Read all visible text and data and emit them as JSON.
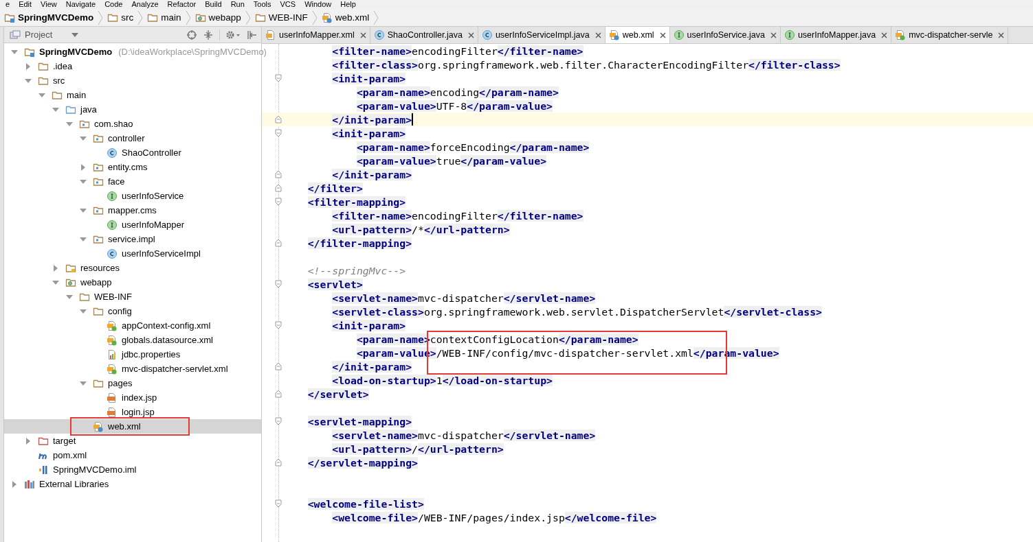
{
  "menu": [
    "e",
    "Edit",
    "View",
    "Navigate",
    "Code",
    "Analyze",
    "Refactor",
    "Build",
    "Run",
    "Tools",
    "VCS",
    "Window",
    "Help"
  ],
  "breadcrumbs": [
    {
      "label": "SpringMVCDemo",
      "kind": "project"
    },
    {
      "label": "src",
      "kind": "folder"
    },
    {
      "label": "main",
      "kind": "folder"
    },
    {
      "label": "webapp",
      "kind": "web"
    },
    {
      "label": "WEB-INF",
      "kind": "folder"
    },
    {
      "label": "web.xml",
      "kind": "webxml"
    }
  ],
  "project_panel": {
    "title": "Project",
    "items": [
      {
        "label": "SpringMVCDemo",
        "path": "(D:\\ideaWorkplace\\SpringMVCDemo)",
        "kind": "project",
        "expanded": true,
        "selected": false,
        "children": [
          {
            "label": ".idea",
            "kind": "folder",
            "expanded": false,
            "selected": false
          },
          {
            "label": "src",
            "kind": "folder",
            "expanded": true,
            "selected": false,
            "children": [
              {
                "label": "main",
                "kind": "folder",
                "expanded": true,
                "selected": false,
                "children": [
                  {
                    "label": "java",
                    "kind": "source",
                    "expanded": true,
                    "selected": false,
                    "children": [
                      {
                        "label": "com.shao",
                        "kind": "package",
                        "expanded": true,
                        "selected": false,
                        "children": [
                          {
                            "label": "controller",
                            "kind": "package",
                            "expanded": true,
                            "selected": false,
                            "children": [
                              {
                                "label": "ShaoController",
                                "kind": "class",
                                "selected": false
                              }
                            ]
                          },
                          {
                            "label": "entity.cms",
                            "kind": "package",
                            "expanded": false,
                            "selected": false
                          },
                          {
                            "label": "face",
                            "kind": "package",
                            "expanded": true,
                            "selected": false,
                            "children": [
                              {
                                "label": "userInfoService",
                                "kind": "interface",
                                "selected": false
                              }
                            ]
                          },
                          {
                            "label": "mapper.cms",
                            "kind": "package",
                            "expanded": true,
                            "selected": false,
                            "children": [
                              {
                                "label": "userInfoMapper",
                                "kind": "interface",
                                "selected": false
                              }
                            ]
                          },
                          {
                            "label": "service.impl",
                            "kind": "package",
                            "expanded": true,
                            "selected": false,
                            "children": [
                              {
                                "label": "userInfoServiceImpl",
                                "kind": "class",
                                "selected": false
                              }
                            ]
                          }
                        ]
                      }
                    ]
                  },
                  {
                    "label": "resources",
                    "kind": "resources",
                    "expanded": false,
                    "selected": false
                  },
                  {
                    "label": "webapp",
                    "kind": "web",
                    "expanded": true,
                    "selected": false,
                    "children": [
                      {
                        "label": "WEB-INF",
                        "kind": "folder",
                        "expanded": true,
                        "selected": false,
                        "children": [
                          {
                            "label": "config",
                            "kind": "folder",
                            "expanded": true,
                            "selected": false,
                            "children": [
                              {
                                "label": "appContext-config.xml",
                                "kind": "springxml",
                                "selected": false
                              },
                              {
                                "label": "globals.datasource.xml",
                                "kind": "springxml",
                                "selected": false
                              },
                              {
                                "label": "jdbc.properties",
                                "kind": "properties",
                                "selected": false
                              },
                              {
                                "label": "mvc-dispatcher-servlet.xml",
                                "kind": "springxml",
                                "selected": false
                              }
                            ]
                          },
                          {
                            "label": "pages",
                            "kind": "folder",
                            "expanded": true,
                            "selected": false,
                            "children": [
                              {
                                "label": "index.jsp",
                                "kind": "jsp",
                                "selected": false
                              },
                              {
                                "label": "login.jsp",
                                "kind": "jsp",
                                "selected": false
                              }
                            ]
                          },
                          {
                            "label": "web.xml",
                            "kind": "webxml",
                            "selected": true,
                            "annotated": true
                          }
                        ]
                      }
                    ]
                  }
                ]
              }
            ]
          },
          {
            "label": "target",
            "kind": "excluded",
            "expanded": false,
            "selected": false
          },
          {
            "label": "pom.xml",
            "kind": "maven",
            "selected": false
          },
          {
            "label": "SpringMVCDemo.iml",
            "kind": "iml",
            "selected": false
          }
        ]
      },
      {
        "label": "External Libraries",
        "kind": "library",
        "expanded": false,
        "selected": false
      }
    ]
  },
  "tabs": [
    {
      "label": "userInfoMapper.xml",
      "kind": "xml",
      "selected": false
    },
    {
      "label": "ShaoController.java",
      "kind": "class",
      "selected": false
    },
    {
      "label": "userInfoServiceImpl.java",
      "kind": "class",
      "selected": false
    },
    {
      "label": "web.xml",
      "kind": "webxml",
      "selected": true
    },
    {
      "label": "userInfoService.java",
      "kind": "interface",
      "selected": false
    },
    {
      "label": "userInfoMapper.java",
      "kind": "interface",
      "selected": false
    },
    {
      "label": "mvc-dispatcher-servle",
      "kind": "springxml",
      "selected": false
    }
  ],
  "editor": {
    "lines": [
      {
        "kind": "continued",
        "children": [
          {
            "kind": "code",
            "segments": [
              {
                "kind": "tag",
                "text": "<filter-name>"
              },
              {
                "kind": "text",
                "text": "encodingFilter"
              },
              {
                "kind": "tag",
                "text": "</filter-name>"
              }
            ]
          },
          {
            "kind": "code",
            "segments": [
              {
                "kind": "tag",
                "text": "<filter-class>"
              },
              {
                "kind": "text",
                "text": "org.springframework.web.filter.CharacterEncodingFilter"
              },
              {
                "kind": "tag",
                "text": "</filter-class>"
              }
            ]
          },
          {
            "kind": "code",
            "fold_start": true,
            "segments": [
              {
                "kind": "tag",
                "text": "<init-param>"
              }
            ],
            "children": [
              {
                "kind": "code",
                "segments": [
                  {
                    "kind": "tag",
                    "text": "<param-name>"
                  },
                  {
                    "kind": "text",
                    "text": "encoding"
                  },
                  {
                    "kind": "tag",
                    "text": "</param-name>"
                  }
                ]
              },
              {
                "kind": "code",
                "segments": [
                  {
                    "kind": "tag",
                    "text": "<param-value>"
                  },
                  {
                    "kind": "text",
                    "text": "UTF-8"
                  },
                  {
                    "kind": "tag",
                    "text": "</param-value>"
                  }
                ]
              }
            ]
          },
          {
            "kind": "code",
            "fold_end": true,
            "current": true,
            "segments": [
              {
                "kind": "tag",
                "text": "</init-param>"
              }
            ]
          },
          {
            "kind": "code",
            "fold_start": true,
            "segments": [
              {
                "kind": "tag",
                "text": "<init-param>"
              }
            ],
            "children": [
              {
                "kind": "code",
                "segments": [
                  {
                    "kind": "tag",
                    "text": "<param-name>"
                  },
                  {
                    "kind": "text",
                    "text": "forceEncoding"
                  },
                  {
                    "kind": "tag",
                    "text": "</param-name>"
                  }
                ]
              },
              {
                "kind": "code",
                "segments": [
                  {
                    "kind": "tag",
                    "text": "<param-value>"
                  },
                  {
                    "kind": "text",
                    "text": "true"
                  },
                  {
                    "kind": "tag",
                    "text": "</param-value>"
                  }
                ]
              }
            ]
          },
          {
            "kind": "code",
            "fold_end": true,
            "segments": [
              {
                "kind": "tag",
                "text": "</init-param>"
              }
            ]
          }
        ]
      },
      {
        "kind": "code",
        "fold_end": true,
        "segments": [
          {
            "kind": "tag",
            "text": "</filter>"
          }
        ]
      },
      {
        "kind": "code",
        "fold_start": true,
        "segments": [
          {
            "kind": "tag",
            "text": "<filter-mapping>"
          }
        ],
        "children": [
          {
            "kind": "code",
            "segments": [
              {
                "kind": "tag",
                "text": "<filter-name>"
              },
              {
                "kind": "text",
                "text": "encodingFilter"
              },
              {
                "kind": "tag",
                "text": "</filter-name>"
              }
            ]
          },
          {
            "kind": "code",
            "segments": [
              {
                "kind": "tag",
                "text": "<url-pattern>"
              },
              {
                "kind": "text",
                "text": "/*"
              },
              {
                "kind": "tag",
                "text": "</url-pattern>"
              }
            ]
          }
        ]
      },
      {
        "kind": "code",
        "fold_end": true,
        "segments": [
          {
            "kind": "tag",
            "text": "</filter-mapping>"
          }
        ]
      },
      {
        "kind": "blank"
      },
      {
        "kind": "code",
        "segments": [
          {
            "kind": "comment",
            "text": "<!--springMvc-->"
          }
        ]
      },
      {
        "kind": "code",
        "fold_start": true,
        "segments": [
          {
            "kind": "tag",
            "text": "<servlet>"
          }
        ],
        "children": [
          {
            "kind": "code",
            "segments": [
              {
                "kind": "tag",
                "text": "<servlet-name>"
              },
              {
                "kind": "text",
                "text": "mvc-dispatcher"
              },
              {
                "kind": "tag",
                "text": "</servlet-name>"
              }
            ]
          },
          {
            "kind": "code",
            "segments": [
              {
                "kind": "tag",
                "text": "<servlet-class>"
              },
              {
                "kind": "text",
                "text": "org.springframework.web.servlet.DispatcherServlet"
              },
              {
                "kind": "tag",
                "text": "</servlet-class>"
              }
            ]
          },
          {
            "kind": "code",
            "fold_start": true,
            "segments": [
              {
                "kind": "tag",
                "text": "<init-param>"
              }
            ],
            "children": [
              {
                "kind": "code",
                "boxed": true,
                "segments": [
                  {
                    "kind": "tag",
                    "text": "<param-name>"
                  },
                  {
                    "kind": "text",
                    "text": "contextConfigLocation"
                  },
                  {
                    "kind": "tag",
                    "text": "</param-name>"
                  }
                ]
              },
              {
                "kind": "code",
                "boxed": true,
                "segments": [
                  {
                    "kind": "tag",
                    "text": "<param-value>"
                  },
                  {
                    "kind": "text",
                    "text": "/WEB-INF/config/mvc-dispatcher-servlet.xml"
                  },
                  {
                    "kind": "tag",
                    "text": "</param-value>"
                  }
                ]
              }
            ]
          },
          {
            "kind": "code",
            "fold_end": true,
            "segments": [
              {
                "kind": "tag",
                "text": "</init-param>"
              }
            ]
          },
          {
            "kind": "code",
            "segments": [
              {
                "kind": "tag",
                "text": "<load-on-startup>"
              },
              {
                "kind": "text",
                "text": "1"
              },
              {
                "kind": "tag",
                "text": "</load-on-startup>"
              }
            ]
          }
        ]
      },
      {
        "kind": "code",
        "fold_end": true,
        "segments": [
          {
            "kind": "tag",
            "text": "</servlet>"
          }
        ]
      },
      {
        "kind": "blank"
      },
      {
        "kind": "code",
        "fold_start": true,
        "segments": [
          {
            "kind": "tag",
            "text": "<servlet-mapping>"
          }
        ],
        "children": [
          {
            "kind": "code",
            "segments": [
              {
                "kind": "tag",
                "text": "<servlet-name>"
              },
              {
                "kind": "text",
                "text": "mvc-dispatcher"
              },
              {
                "kind": "tag",
                "text": "</servlet-name>"
              }
            ]
          },
          {
            "kind": "code",
            "segments": [
              {
                "kind": "tag",
                "text": "<url-pattern>"
              },
              {
                "kind": "text",
                "text": "/"
              },
              {
                "kind": "tag",
                "text": "</url-pattern>"
              }
            ]
          }
        ]
      },
      {
        "kind": "code",
        "fold_end": true,
        "segments": [
          {
            "kind": "tag",
            "text": "</servlet-mapping>"
          }
        ]
      },
      {
        "kind": "blank"
      },
      {
        "kind": "blank"
      },
      {
        "kind": "code",
        "fold_start": true,
        "segments": [
          {
            "kind": "tag",
            "text": "<welcome-file-list>"
          }
        ],
        "children": [
          {
            "kind": "code",
            "segments": [
              {
                "kind": "tag",
                "text": "<welcome-file>"
              },
              {
                "kind": "text",
                "text": "/WEB-INF/pages/index.jsp"
              },
              {
                "kind": "tag",
                "text": "</welcome-file>"
              }
            ]
          }
        ]
      }
    ]
  }
}
